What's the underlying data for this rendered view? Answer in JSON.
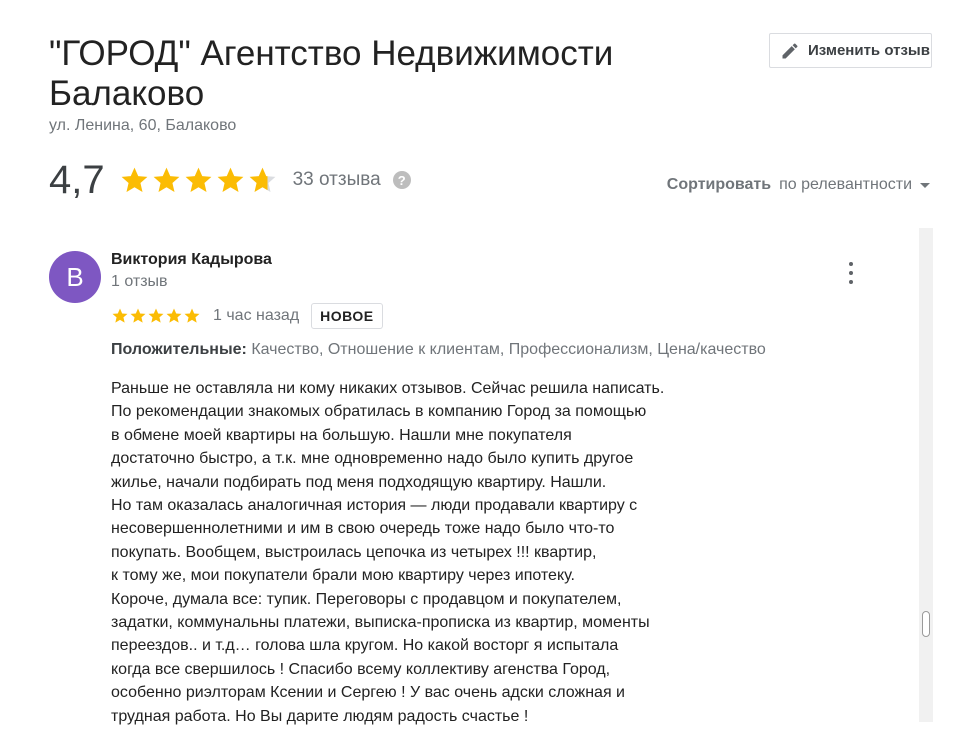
{
  "header": {
    "title": "\"ГОРОД\" Агентство Недвижимости Балаково",
    "address": "ул. Ленина, 60, Балаково",
    "edit_button_label": "Изменить отзыв"
  },
  "summary": {
    "rating": "4,7",
    "stars_filled": 4.7,
    "review_count": "33 отзыва"
  },
  "sort": {
    "label": "Сортировать",
    "value": "по релевантности"
  },
  "review": {
    "avatar_letter": "В",
    "author": "Виктория Кадырова",
    "author_meta": "1 отзыв",
    "stars": 5,
    "time": "1 час назад",
    "badge": "НОВОЕ",
    "positives_label": "Положительные:",
    "positives_value": "Качество, Отношение к клиентам, Профессионализм, Цена/качество",
    "lines": [
      "Раньше не оставляла ни кому никаких отзывов. Сейчас решила написать.",
      "По рекомендации знакомых обратилась в компанию Город за помощью",
      "в обмене моей квартиры на большую. Нашли мне покупателя",
      "достаточно быстро, а т.к. мне одновременно надо было купить другое",
      "жилье, начали подбирать под меня подходящую квартиру. Нашли.",
      "Но там оказалась аналогичная история — люди продавали квартиру с",
      "несовершеннолетними и им в свою очередь тоже надо было что-то",
      "покупать. Вообщем, выстроилась цепочка из четырех !!! квартир,",
      "к тому же, мои покупатели брали мою квартиру через ипотеку.",
      "Короче, думала все: тупик. Переговоры с продавцом и покупателем,",
      "задатки, коммунальны платежи, выписка-прописка из квартир, моменты",
      "переездов..  и т.д… голова шла кругом. Но какой восторг я испытала",
      "когда все свершилось ! Спасибо всему коллективу агенства Город,",
      "особенно риэлторам Ксении и Сергею ! У вас очень адски сложная и",
      "трудная работа. Но Вы дарите людям радость счастье !"
    ]
  },
  "colors": {
    "star": "#fbbc04",
    "star_empty": "#dadce0",
    "avatar": "#7e57c2",
    "muted": "#70757a"
  }
}
